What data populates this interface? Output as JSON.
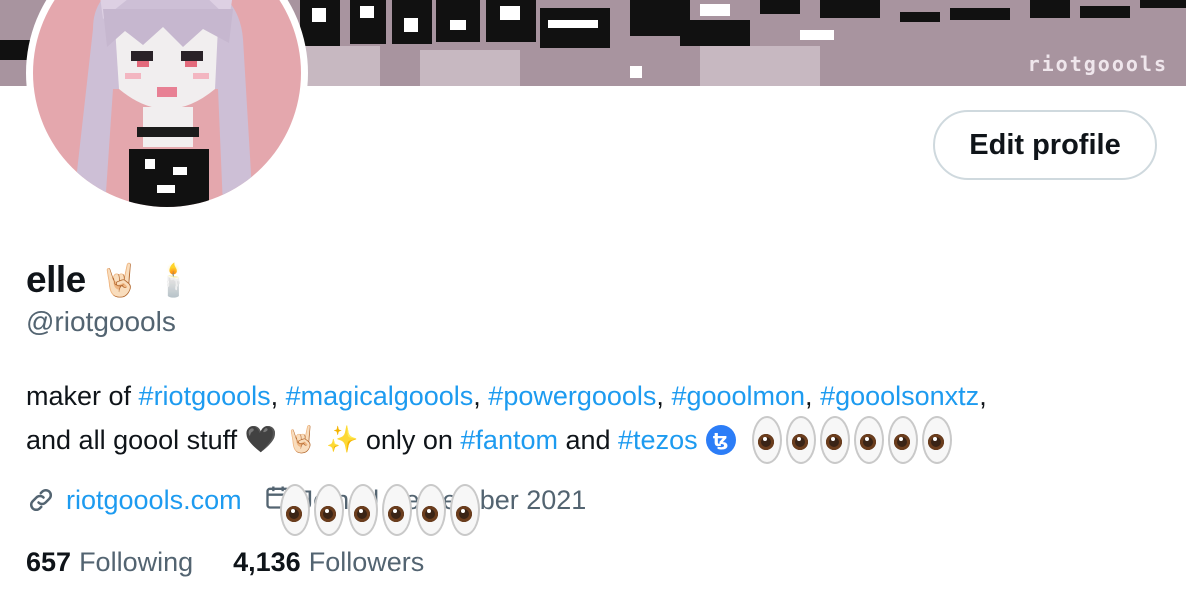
{
  "banner": {
    "signature": "riotgoools"
  },
  "profile": {
    "display_name": "elle",
    "name_emojis": [
      "🤘🏻",
      "🕯️"
    ],
    "handle": "@riotgoools",
    "edit_button": "Edit profile"
  },
  "bio": {
    "line1_prefix": "maker of ",
    "hashtags_line1": [
      "#riotgoools",
      "#magicalgoools",
      "#powergoools",
      "#gooolmon",
      "#gooolsonxtz"
    ],
    "sep": ", ",
    "line1_suffix": ",",
    "line2_prefix": "and all goool stuff ",
    "line2_emojis": "🖤 🤘🏻 ✨",
    "line2_mid": " only on ",
    "tag_fantom": "#fantom",
    "and_text": " and ",
    "tag_tezos": "#tezos",
    "tezos_icon": "ꜩ",
    "eyes_count": 6
  },
  "meta": {
    "link_icon": "link-icon",
    "link_text": "riotgoools.com",
    "calendar_icon": "calendar-icon",
    "joined_text": "Joined September 2021"
  },
  "stats": {
    "following_count": "657",
    "following_label": "Following",
    "followers_count": "4,136",
    "followers_label": "Followers"
  },
  "colors": {
    "link_blue": "#1d9bf0",
    "secondary_text": "#536471",
    "primary_text": "#0f1419",
    "button_border": "#cfd9de",
    "banner_bg": "#a8949f",
    "avatar_bg": "#e4a7ad"
  }
}
